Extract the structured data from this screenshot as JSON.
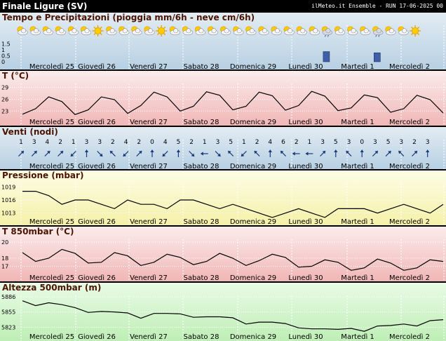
{
  "header": {
    "location": "Finale Ligure (SV)",
    "source": "ilMeteo.it Ensemble - RUN 17-06-2025 00"
  },
  "days": [
    "Mercoledì 25",
    "Giovedì 26",
    "Venerdì 27",
    "Sabato 28",
    "Domenica 29",
    "Lunedì 30",
    "Martedì 1",
    "Mercoledì 2"
  ],
  "chart_data": [
    {
      "id": "precip",
      "type": "bar",
      "title": "Tempo e Precipitazioni (pioggia mm/6h - neve cm/6h)",
      "yticks": [
        "1.5",
        "1",
        "0.5",
        "0"
      ],
      "ylim": [
        0,
        2
      ],
      "x": [
        0,
        1,
        2,
        3,
        4,
        5,
        6,
        7,
        8,
        9,
        10,
        11,
        12,
        13,
        14,
        15,
        16,
        17,
        18,
        19,
        20,
        21,
        22,
        23,
        24,
        25,
        26,
        27,
        28,
        29,
        30,
        31
      ],
      "values": [
        0,
        0,
        0,
        0,
        0,
        0,
        0,
        0,
        0,
        0,
        0,
        0,
        0,
        0,
        0,
        0,
        0,
        0,
        0,
        0,
        0,
        0,
        0,
        0,
        0.85,
        0,
        0,
        0,
        0.75,
        0,
        0,
        0
      ],
      "weather_icons": [
        "partly-cloudy",
        "partly-cloudy",
        "partly-cloudy",
        "partly-cloudy",
        "partly-cloudy",
        "partly-cloudy",
        "sunny",
        "partly-cloudy",
        "partly-cloudy",
        "partly-cloudy",
        "partly-cloudy",
        "sunny",
        "partly-cloudy",
        "partly-cloudy",
        "partly-cloudy",
        "partly-cloudy",
        "partly-cloudy",
        "partly-cloudy",
        "partly-cloudy",
        "partly-cloudy",
        "partly-cloudy",
        "partly-cloudy",
        "partly-cloudy",
        "partly-cloudy",
        "rain-cloud",
        "partly-cloudy",
        "partly-cloudy",
        "partly-cloudy",
        "rain-cloud",
        "partly-cloudy",
        "partly-cloudy",
        "sunny"
      ]
    },
    {
      "id": "temp",
      "type": "line",
      "title": "T (°C)",
      "yticks": [
        29,
        26,
        23
      ],
      "ylim": [
        21.8,
        30
      ],
      "values": [
        22.2,
        23.6,
        26.6,
        25.4,
        22.1,
        23.3,
        26.6,
        25.9,
        22.4,
        24.4,
        27.8,
        26.6,
        23.0,
        24.2,
        27.9,
        27.0,
        23.3,
        24.2,
        27.8,
        26.9,
        23.2,
        24.4,
        28.0,
        26.8,
        23.1,
        23.8,
        27.1,
        26.4,
        22.7,
        23.6,
        27.0,
        25.9,
        22.5
      ]
    },
    {
      "id": "wind",
      "type": "table",
      "title": "Venti (nodi)",
      "speeds": [
        1,
        3,
        4,
        2,
        1,
        3,
        3,
        2,
        4,
        2,
        0,
        4,
        5,
        2,
        1,
        3,
        5,
        1,
        2,
        4,
        6,
        2,
        1,
        3,
        5,
        3,
        0,
        3,
        5,
        3,
        2,
        3
      ],
      "directions_deg": [
        45,
        45,
        45,
        45,
        225,
        0,
        135,
        315,
        225,
        45,
        0,
        225,
        0,
        135,
        270,
        135,
        315,
        225,
        315,
        0,
        315,
        270,
        270,
        45,
        0,
        315,
        0,
        45,
        45,
        315,
        45,
        0
      ]
    },
    {
      "id": "pressure",
      "type": "line",
      "title": "Pressione (mbar)",
      "yticks": [
        1019,
        1016,
        1013
      ],
      "ylim": [
        1011.5,
        1020.5
      ],
      "values": [
        1018,
        1018,
        1017,
        1015,
        1016,
        1016,
        1015,
        1014,
        1016,
        1015,
        1015,
        1014,
        1016,
        1016,
        1015,
        1014,
        1015,
        1014,
        1013,
        1012,
        1013,
        1014,
        1013,
        1012,
        1014,
        1014,
        1014,
        1013,
        1014,
        1015,
        1014,
        1013,
        1015
      ]
    },
    {
      "id": "t850",
      "type": "line",
      "title": "T 850mbar (°C)",
      "yticks": [
        20,
        18,
        17
      ],
      "ylim": [
        16.0,
        20.7
      ],
      "values": [
        18.7,
        17.6,
        18.0,
        19.1,
        18.6,
        17.4,
        17.5,
        18.7,
        18.3,
        17.1,
        17.5,
        18.5,
        18.1,
        17.2,
        17.6,
        18.6,
        18.0,
        17.1,
        17.7,
        18.5,
        18.1,
        16.9,
        17.0,
        17.8,
        17.5,
        16.5,
        16.8,
        17.9,
        17.4,
        16.5,
        16.8,
        17.8,
        17.6
      ]
    },
    {
      "id": "z500",
      "type": "line",
      "title": "Altezza 500mbar (m)",
      "yticks": [
        5886,
        5855,
        5823
      ],
      "ylim": [
        5808,
        5895
      ],
      "values": [
        5878,
        5868,
        5874,
        5870,
        5864,
        5854,
        5856,
        5855,
        5853,
        5842,
        5852,
        5852,
        5851,
        5844,
        5845,
        5845,
        5843,
        5830,
        5834,
        5834,
        5831,
        5822,
        5820,
        5820,
        5819,
        5821,
        5815,
        5826,
        5827,
        5830,
        5826,
        5837,
        5839
      ]
    }
  ],
  "colors": {
    "precip_bg_top": "#e3ecf3",
    "precip_bg_bottom": "#b7d0e3",
    "temp_bg_top": "#fbecec",
    "temp_bg_bottom": "#f1b6b6",
    "wind_bg_top": "#e3ecf3",
    "wind_bg_bottom": "#b7d0e3",
    "pressure_bg_top": "#fdfde6",
    "pressure_bg_bottom": "#f5f0a8",
    "t850_bg_top": "#fbecec",
    "t850_bg_bottom": "#f1b6b6",
    "z500_bg_top": "#e9fbe6",
    "z500_bg_bottom": "#bfeeb6",
    "bar": "#3e5fa6",
    "line": "#000000",
    "title": "#4a1400"
  }
}
